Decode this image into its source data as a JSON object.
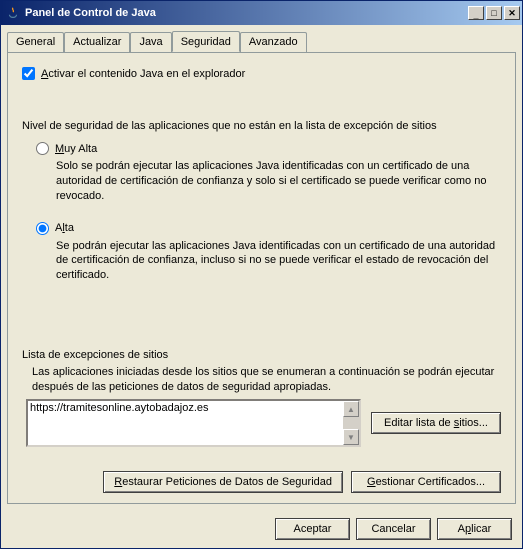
{
  "window": {
    "title": "Panel de Control de Java"
  },
  "tabs": {
    "general": "General",
    "actualizar": "Actualizar",
    "java": "Java",
    "seguridad": "Seguridad",
    "avanzado": "Avanzado"
  },
  "security": {
    "enable_label_a": "A",
    "enable_label_rest": "ctivar el contenido Java en el explorador",
    "level_heading": "Nivel de seguridad de las aplicaciones que no están en la lista de excepción de sitios",
    "option_very_high_u": "M",
    "option_very_high_rest": "uy Alta",
    "very_high_desc": "Solo se podrán ejecutar las aplicaciones Java identificadas con un certificado de una autoridad de certificación de confianza y solo si el certificado se puede verificar como no revocado.",
    "option_high_u": "l",
    "option_high_pre": "A",
    "option_high_post": "ta",
    "high_desc": "Se podrán ejecutar las aplicaciones Java identificadas con un certificado de una autoridad de certificación de confianza, incluso si no se puede verificar el estado de revocación del certificado.",
    "site_list_heading": "Lista de excepciones de sitios",
    "site_list_desc": "Las aplicaciones iniciadas desde los sitios que se enumeran a continuación se podrán ejecutar después de las peticiones de datos de seguridad apropiadas.",
    "site0": "https://tramitesonline.aytobadajoz.es",
    "edit_list_pre": "Editar lista de ",
    "edit_list_u": "s",
    "edit_list_post": "itios...",
    "restore_pre": "",
    "restore_u": "R",
    "restore_post": "estaurar Peticiones de Datos de Seguridad",
    "manage_pre": "",
    "manage_u": "G",
    "manage_post": "estionar Certificados..."
  },
  "buttons": {
    "ok": "Aceptar",
    "cancel": "Cancelar",
    "apply_pre": "A",
    "apply_u": "p",
    "apply_post": "licar"
  }
}
